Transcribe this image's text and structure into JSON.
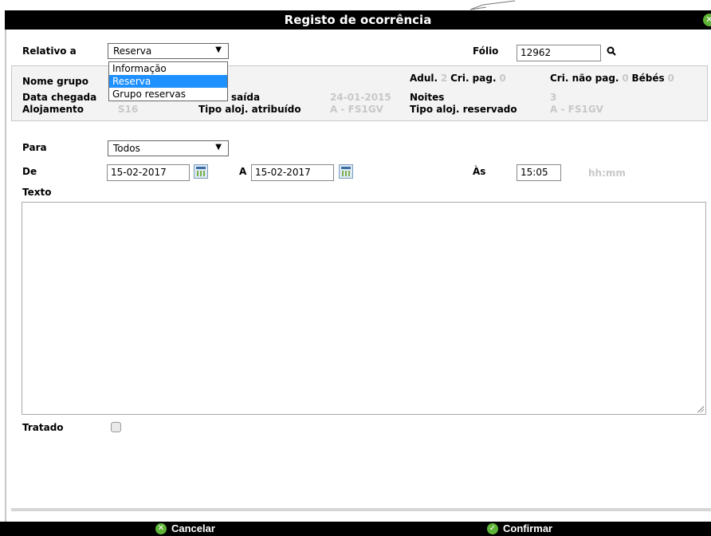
{
  "dialog": {
    "title": "Registo de ocorrência",
    "close_glyph": "✕"
  },
  "relativo": {
    "label": "Relativo a",
    "value": "Reserva",
    "options": [
      "Informação",
      "Reserva",
      "Grupo reservas"
    ],
    "selected_index": 1
  },
  "folio": {
    "label": "Fólio",
    "value": "12962"
  },
  "info": {
    "nome_grupo_label": "Nome grupo",
    "data_chegada_label": "Data chegada",
    "data_saida_label": "saída",
    "data_saida_value": "24-01-2015",
    "alojamento_label": "Alojamento",
    "alojamento_value": "S16",
    "tipo_atribuido_label": "Tipo aloj. atribuído",
    "tipo_atribuido_value": "A - FS1GV",
    "adul_label": "Adul.",
    "adul_value": "2",
    "cri_pag_label": "Cri. pag.",
    "cri_pag_value": "0",
    "cri_nao_pag_label": "Cri. não pag.",
    "cri_nao_pag_value": "0",
    "bebes_label": "Bébés",
    "bebes_value": "0",
    "noites_label": "Noites",
    "noites_value": "3",
    "tipo_reservado_label": "Tipo aloj. reservado",
    "tipo_reservado_value": "A - FS1GV"
  },
  "para": {
    "label": "Para",
    "value": "Todos"
  },
  "de": {
    "label": "De",
    "value": "15-02-2017"
  },
  "a": {
    "label": "A",
    "value": "15-02-2017"
  },
  "as": {
    "label": "Às",
    "value": "15:05",
    "hint": "hh:mm"
  },
  "texto": {
    "label": "Texto",
    "value": ""
  },
  "tratado": {
    "label": "Tratado",
    "checked": false
  },
  "footer": {
    "cancel_label": "Cancelar",
    "confirm_label": "Confirmar"
  },
  "colors": {
    "accent_green": "#5fb336",
    "highlight_blue": "#1e90ff",
    "muted_value": "#c8c8c8"
  },
  "icons": [
    "pencil-mark-icon",
    "close-icon",
    "search-icon",
    "calendar-icon",
    "chevron-down-icon",
    "cancel-icon",
    "confirm-icon",
    "resize-grip-icon"
  ]
}
